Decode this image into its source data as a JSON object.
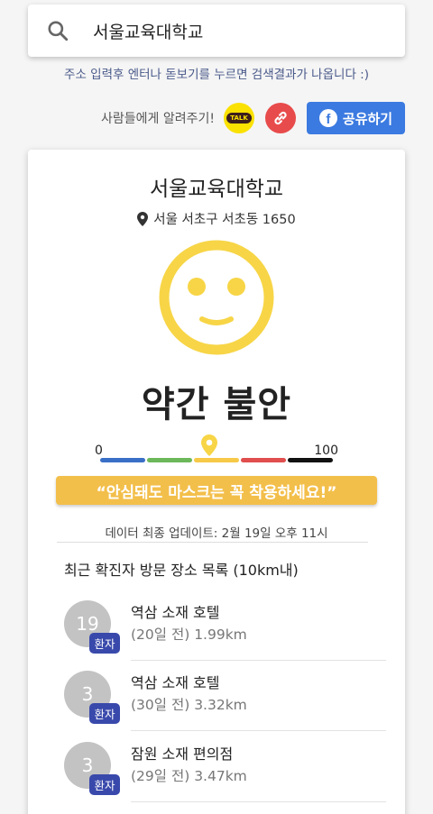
{
  "search": {
    "value": "서울교육대학교",
    "placeholder": "",
    "icon": "search-icon"
  },
  "hint_text": "주소 입력후 엔터나 돋보기를 누르면 검색결과가 나옵니다 :)",
  "share": {
    "label": "사람들에게 알려주기!",
    "kakao_text": "TALK",
    "facebook_label": "공유하기",
    "facebook_icon_text": "f",
    "colors": {
      "kakao": "#fae100",
      "link": "#e84b4b",
      "facebook": "#3b7ae0"
    }
  },
  "place": {
    "name": "서울교육대학교",
    "address": "서울 서초구 서초동 1650",
    "status": "약간 불안",
    "status_color": "#f7d546"
  },
  "gauge": {
    "min_label": "0",
    "max_label": "100",
    "segments": [
      "#3a6fc7",
      "#6cb85a",
      "#f7c948",
      "#e04e4e",
      "#111111"
    ],
    "marker_segment_index": 2
  },
  "advice": "“안심돼도 마스크는 꼭 착용하세요!”",
  "updated": "데이터 최종 업데이트: 2월 19일 오후 11시",
  "list": {
    "title": "최근 확진자 방문 장소 목록 (10km내)",
    "items": [
      {
        "count": "19",
        "badge": "환자",
        "name": "역삼 소재 호텔",
        "meta": "(20일 전) 1.99km"
      },
      {
        "count": "3",
        "badge": "환자",
        "name": "역삼 소재 호텔",
        "meta": "(30일 전) 3.32km"
      },
      {
        "count": "3",
        "badge": "환자",
        "name": "잠원 소재 편의점",
        "meta": "(29일 전) 3.47km"
      }
    ]
  }
}
